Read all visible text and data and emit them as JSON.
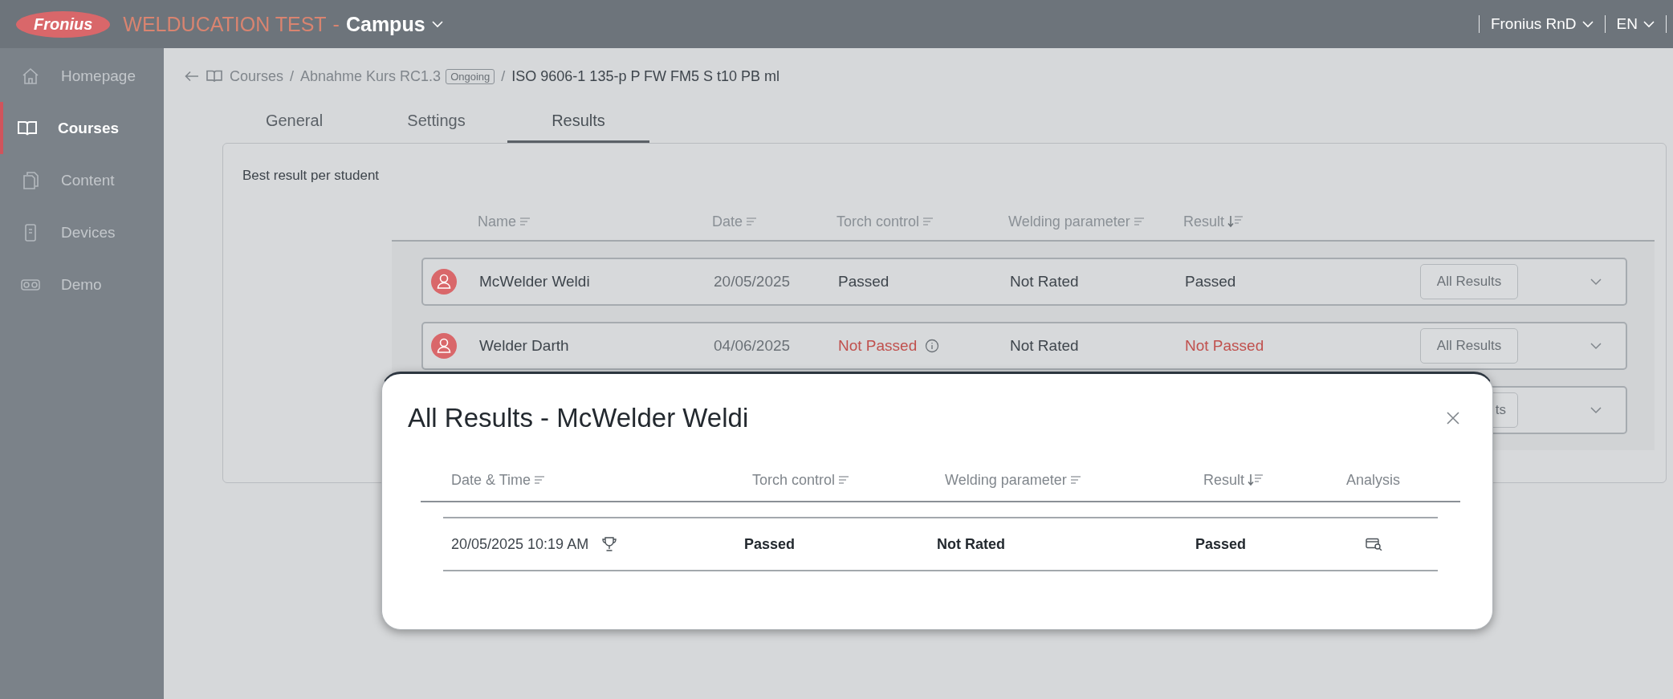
{
  "header": {
    "logo": "Fronius",
    "app_name": "WELDUCATION TEST",
    "separator": "-",
    "workspace": "Campus",
    "account": "Fronius RnD",
    "language": "EN"
  },
  "sidebar": {
    "items": [
      {
        "label": "Homepage",
        "selected": false
      },
      {
        "label": "Courses",
        "selected": true
      },
      {
        "label": "Content",
        "selected": false
      },
      {
        "label": "Devices",
        "selected": false
      },
      {
        "label": "Demo",
        "selected": false
      }
    ]
  },
  "breadcrumb": [
    {
      "kind": "link",
      "text": "Courses"
    },
    {
      "kind": "separator",
      "text": "/"
    },
    {
      "kind": "link",
      "text": "Abnahme Kurs RC1.3"
    },
    {
      "kind": "badge",
      "text": "Ongoing"
    },
    {
      "kind": "separator",
      "text": "/"
    },
    {
      "kind": "current",
      "text": "ISO 9606-1 135-p P FW FM5 S t10 PB ml"
    }
  ],
  "tabs": [
    {
      "label": "General",
      "selected": false
    },
    {
      "label": "Settings",
      "selected": false
    },
    {
      "label": "Results",
      "selected": true
    }
  ],
  "results": {
    "title": "Best result per student",
    "columns": [
      {
        "label": "Name",
        "sorted": false
      },
      {
        "label": "Date",
        "sorted": false
      },
      {
        "label": "Torch control",
        "sorted": false
      },
      {
        "label": "Welding parameter",
        "sorted": false
      },
      {
        "label": "Result",
        "sorted": true
      }
    ],
    "rows": [
      {
        "kind": "student",
        "name": "McWelder Weldi",
        "date": "20/05/2025",
        "torch_control": {
          "text": "Passed",
          "failed": false,
          "info": false
        },
        "welding_parameter": {
          "text": "Not Rated",
          "failed": false,
          "info": false
        },
        "result": {
          "text": "Passed",
          "failed": false,
          "info": false
        },
        "button": "All Results",
        "expanded": false
      },
      {
        "kind": "student",
        "name": "Welder Darth",
        "date": "04/06/2025",
        "torch_control": {
          "text": "Not Passed",
          "failed": true,
          "info": true
        },
        "welding_parameter": {
          "text": "Not Rated",
          "failed": false,
          "info": false
        },
        "result": {
          "text": "Not Passed",
          "failed": true,
          "info": false
        },
        "button": "All Results",
        "expanded": false
      },
      {
        "kind": "covered",
        "button": "ts",
        "expanded": false
      }
    ]
  },
  "modal": {
    "title": "All Results - McWelder Weldi",
    "columns": [
      {
        "label": "Date & Time",
        "sorted": false
      },
      {
        "label": "Torch control",
        "sorted": false
      },
      {
        "label": "Welding parameter",
        "sorted": false
      },
      {
        "label": "Result",
        "sorted": true
      },
      {
        "label": "Analysis"
      }
    ],
    "rows": [
      {
        "date_time": "20/05/2025 10:19 AM",
        "best": true,
        "torch_control": "Passed",
        "welding_parameter": "Not Rated",
        "result": "Passed"
      }
    ]
  }
}
